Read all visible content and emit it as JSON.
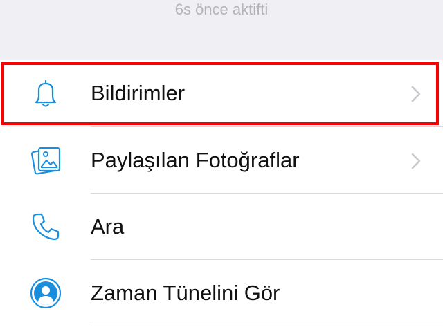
{
  "status_text": "6s önce aktifti",
  "colors": {
    "accent": "#1a8ddc",
    "highlight": "#ff0000",
    "chevron": "#c7c7cc"
  },
  "menu": {
    "items": [
      {
        "label": "Bildirimler",
        "icon": "bell-icon",
        "has_chevron": true
      },
      {
        "label": "Paylaşılan Fotoğraflar",
        "icon": "photos-icon",
        "has_chevron": true
      },
      {
        "label": "Ara",
        "icon": "phone-icon",
        "has_chevron": false
      },
      {
        "label": "Zaman Tünelini Gör",
        "icon": "profile-icon",
        "has_chevron": false
      }
    ]
  }
}
